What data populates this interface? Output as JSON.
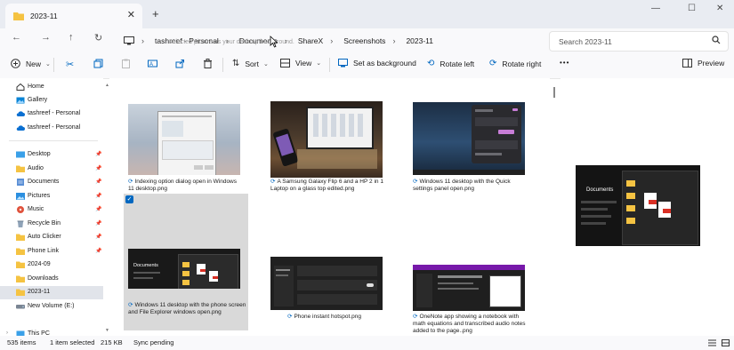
{
  "window": {
    "tab_title": "2023-11",
    "new_tab": "+",
    "close_tab": "✕",
    "minimize": "—",
    "maximize": "☐",
    "close": "✕"
  },
  "nav": {
    "breadcrumb": [
      "tashreef - Personal",
      "Documents",
      "ShareX",
      "Screenshots",
      "2023-11"
    ],
    "tooltip": "selected picture as your desktop background.",
    "search_placeholder": "Search 2023-11"
  },
  "toolbar": {
    "new": "New",
    "sort": "Sort",
    "view": "View",
    "set_background": "Set as background",
    "rotate_left": "Rotate left",
    "rotate_right": "Rotate right",
    "more": "•••",
    "preview": "Preview"
  },
  "sidebar": {
    "items": [
      {
        "label": "Home",
        "icon": "home-icon"
      },
      {
        "label": "Gallery",
        "icon": "gallery-icon"
      },
      {
        "label": "tashreef - Personal",
        "icon": "cloud-icon"
      },
      {
        "label": "tashreef - Personal",
        "icon": "cloud-icon"
      },
      {
        "label": "Desktop",
        "icon": "folder-blue-icon"
      },
      {
        "label": "Audio",
        "icon": "folder-icon"
      },
      {
        "label": "Documents",
        "icon": "documents-icon"
      },
      {
        "label": "Pictures",
        "icon": "pictures-icon"
      },
      {
        "label": "Music",
        "icon": "music-icon"
      },
      {
        "label": "Recycle Bin",
        "icon": "recycle-bin-icon"
      },
      {
        "label": "Auto Clicker",
        "icon": "folder-icon"
      },
      {
        "label": "Phone Link",
        "icon": "folder-icon"
      },
      {
        "label": "2024-09",
        "icon": "folder-icon"
      },
      {
        "label": "Downloads",
        "icon": "folder-icon"
      },
      {
        "label": "2023-11",
        "icon": "folder-icon"
      },
      {
        "label": "New Volume (E:)",
        "icon": "drive-icon"
      },
      {
        "label": "This PC",
        "icon": "pc-icon"
      }
    ]
  },
  "files": [
    {
      "caption": "Indexing option dialog open in Windows 11 desktop.png"
    },
    {
      "caption": "A Samsung Galaxy Flip 6 and a HP 2 in 1 Laptop on a glass top edited.png"
    },
    {
      "caption": "Windows 11 desktop with the Quick settings panel open.png"
    },
    {
      "caption": "Windows 11 desktop with the phone screen and File Explorer windows open.png"
    },
    {
      "caption": "Phone instant hotspot.png"
    },
    {
      "caption": "OneNote app showing a notebook with math equations and transcribed audio notes added to the page..png"
    }
  ],
  "preview": {
    "heading": "Documents"
  },
  "status": {
    "count": "535 items",
    "selected": "1 item selected",
    "size": "215 KB",
    "sync": "Sync pending"
  },
  "colors": {
    "accent": "#0067c0",
    "folder": "#f5c342",
    "selection": "#d9d9d9"
  }
}
